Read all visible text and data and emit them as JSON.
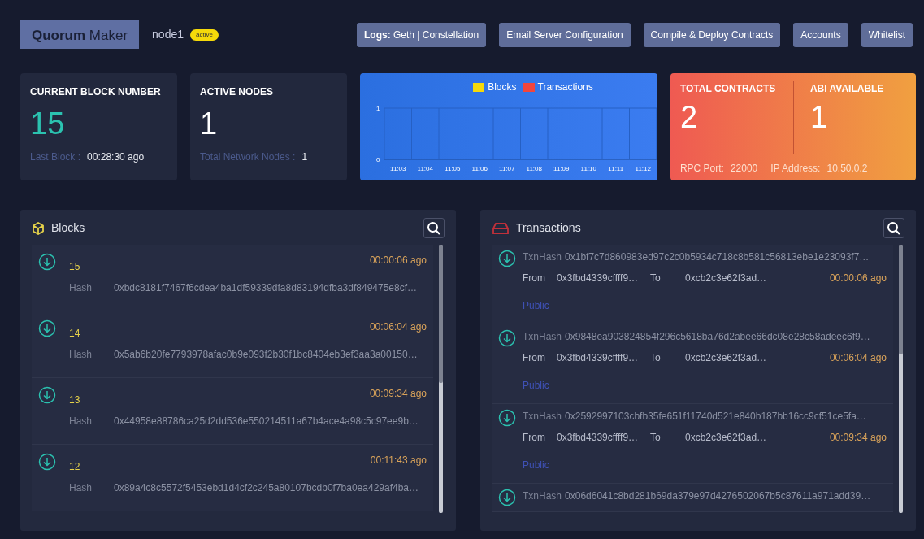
{
  "header": {
    "brand_bold": "Quorum",
    "brand_light": "Maker",
    "node": "node1",
    "status": "active",
    "buttons": [
      {
        "bold": "Logs:",
        "label": "Geth | Constellation"
      },
      {
        "label": "Email Server Configuration"
      },
      {
        "label": "Compile & Deploy Contracts"
      },
      {
        "label": "Accounts"
      },
      {
        "label": "Whitelist"
      }
    ]
  },
  "stats": [
    {
      "title": "CURRENT BLOCK NUMBER",
      "value": "15",
      "accent": true,
      "foot_label": "Last Block :",
      "foot_value": "00:28:30 ago"
    },
    {
      "title": "ACTIVE NODES",
      "value": "1",
      "accent": false,
      "foot_label": "Total Network Nodes :",
      "foot_value": "1"
    }
  ],
  "chart": {
    "chart_data": {
      "type": "line",
      "categories": [
        "11:03",
        "11:04",
        "11:05",
        "11:06",
        "11:07",
        "11:08",
        "11:09",
        "11:10",
        "11:11",
        "11:12"
      ],
      "ylim": [
        0,
        1
      ],
      "yticks": [
        0,
        1
      ],
      "series": [
        {
          "name": "Blocks",
          "color": "#f5d90a",
          "values": [
            null,
            null,
            null,
            null,
            null,
            null,
            null,
            null,
            null,
            null
          ]
        },
        {
          "name": "Transactions",
          "color": "#f2453d",
          "values": [
            null,
            null,
            null,
            null,
            null,
            null,
            null,
            null,
            null,
            null
          ]
        }
      ]
    }
  },
  "contracts": {
    "items": [
      {
        "title": "TOTAL CONTRACTS",
        "value": "2"
      },
      {
        "title": "ABI AVAILABLE",
        "value": "1"
      }
    ],
    "rpc_label": "RPC Port:",
    "rpc_value": "22000",
    "ip_label": "IP Address:",
    "ip_value": "10.50.0.2"
  },
  "blocks": {
    "title": "Blocks",
    "items": [
      {
        "number": "15",
        "time": "00:00:06 ago",
        "hash_label": "Hash",
        "hash": "0xbdc8181f7467f6cdea4ba1df59339dfa8d83194dfba3df849475e8cf…"
      },
      {
        "number": "14",
        "time": "00:06:04 ago",
        "hash_label": "Hash",
        "hash": "0x5ab6b20fe7793978afac0b9e093f2b30f1bc8404eb3ef3aa3a00150…"
      },
      {
        "number": "13",
        "time": "00:09:34 ago",
        "hash_label": "Hash",
        "hash": "0x44958e88786ca25d2dd536e550214511a67b4ace4a98c5c97ee9b…"
      },
      {
        "number": "12",
        "time": "00:11:43 ago",
        "hash_label": "Hash",
        "hash": "0x89a4c8c5572f5453ebd1d4cf2c245a80107bcdb0f7ba0ea429af4ba…"
      }
    ]
  },
  "transactions": {
    "title": "Transactions",
    "items": [
      {
        "hash_label": "TxnHash",
        "hash": "0x1bf7c7d860983ed97c2c0b5934c718c8b581c56813ebe1e23093f7…",
        "from_label": "From",
        "from": "0x3fbd4339cffff9…",
        "to_label": "To",
        "to": "0xcb2c3e62f3ad…",
        "time": "00:00:06 ago",
        "privacy": "Public"
      },
      {
        "hash_label": "TxnHash",
        "hash": "0x9848ea903824854f296c5618ba76d2abee66dc08e28c58adeec6f9…",
        "from_label": "From",
        "from": "0x3fbd4339cffff9…",
        "to_label": "To",
        "to": "0xcb2c3e62f3ad…",
        "time": "00:06:04 ago",
        "privacy": "Public"
      },
      {
        "hash_label": "TxnHash",
        "hash": "0x2592997103cbfb35fe651f11740d521e840b187bb16cc9cf51ce5fa…",
        "from_label": "From",
        "from": "0x3fbd4339cffff9…",
        "to_label": "To",
        "to": "0xcb2c3e62f3ad…",
        "time": "00:09:34 ago",
        "privacy": "Public"
      },
      {
        "hash_label": "TxnHash",
        "hash": "0x06d6041c8bd281b69da379e97d4276502067b5c87611a971add39…"
      }
    ]
  }
}
